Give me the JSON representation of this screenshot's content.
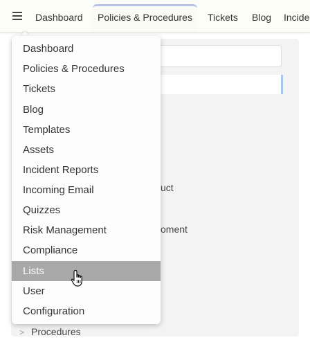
{
  "nav": {
    "menu_icon": "hamburger-icon",
    "tabs": [
      {
        "label": "Dashboard"
      },
      {
        "label": "Policies & Procedures",
        "active": true
      },
      {
        "label": "Tickets"
      },
      {
        "label": "Blog"
      },
      {
        "label": "Incide"
      }
    ]
  },
  "background": {
    "fragment_1": "uct",
    "fragment_2": "oment",
    "tree_item": "Procedures"
  },
  "menu": {
    "items": [
      {
        "label": "Dashboard"
      },
      {
        "label": "Policies & Procedures"
      },
      {
        "label": "Tickets"
      },
      {
        "label": "Blog"
      },
      {
        "label": "Templates"
      },
      {
        "label": "Assets"
      },
      {
        "label": "Incident Reports"
      },
      {
        "label": "Incoming Email"
      },
      {
        "label": "Quizzes"
      },
      {
        "label": "Risk Management"
      },
      {
        "label": "Compliance"
      },
      {
        "label": "Lists",
        "hovered": true
      },
      {
        "label": "User"
      },
      {
        "label": "Configuration"
      }
    ]
  },
  "colors": {
    "topbar_bg": "#fdfdf8",
    "active_tab_border": "#b9c2e8",
    "menu_hover_bg": "#a8a8a8",
    "panel_bg": "#f3f3f3"
  }
}
